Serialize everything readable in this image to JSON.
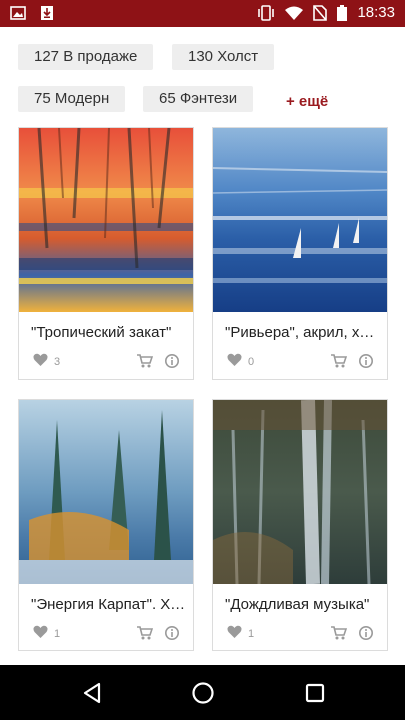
{
  "status_bar": {
    "time": "18:33",
    "icons": [
      "gallery-icon",
      "download-icon",
      "vibrate-icon",
      "wifi-icon",
      "no-sim-icon",
      "battery-icon"
    ]
  },
  "filters": {
    "tags": [
      {
        "label": "127 В продаже"
      },
      {
        "label": "130 Холст"
      },
      {
        "label": "75 Модерн"
      },
      {
        "label": "65 Фэнтези"
      }
    ],
    "more_label": "+ ещё"
  },
  "cards": [
    {
      "title": "\"Тропический закат\"",
      "likes": "3",
      "image": "red-orange abstract rain painting"
    },
    {
      "title": "\"Ривьера\", акрил, холст",
      "likes": "0",
      "image": "blue sea with sailboats painting"
    },
    {
      "title": "\"Энергия Карпат\". Холст",
      "likes": "1",
      "image": "fir trees by water painting"
    },
    {
      "title": "\"Дождливая музыка\"",
      "likes": "1",
      "image": "dark forest waterfall painting"
    }
  ],
  "colors": {
    "accent": "#8e1216",
    "link": "#9a1a1f",
    "tag_bg": "#eeeeee",
    "icon_gray": "#9a9a9a"
  },
  "navigation": {
    "icons": [
      "back-icon",
      "home-icon",
      "recents-icon"
    ]
  }
}
